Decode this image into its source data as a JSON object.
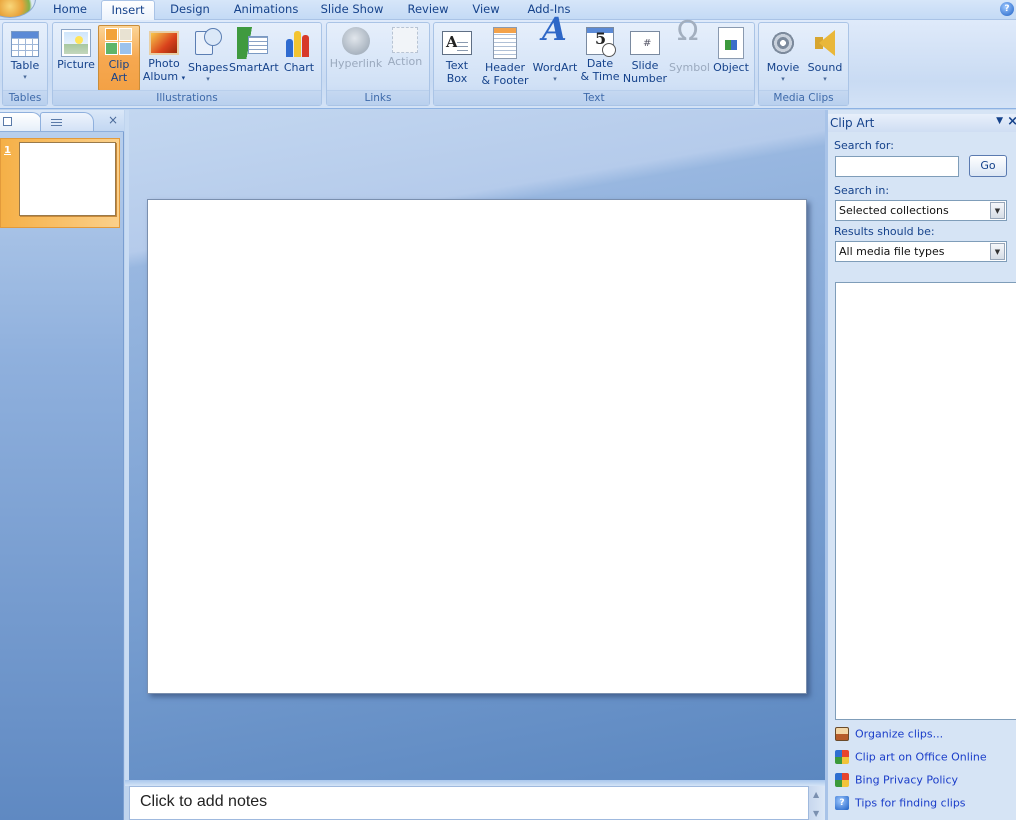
{
  "tabs": [
    {
      "label": "Home",
      "active": false
    },
    {
      "label": "Insert",
      "active": true
    },
    {
      "label": "Design",
      "active": false
    },
    {
      "label": "Animations",
      "active": false
    },
    {
      "label": "Slide Show",
      "active": false
    },
    {
      "label": "Review",
      "active": false
    },
    {
      "label": "View",
      "active": false
    },
    {
      "label": "Add-Ins",
      "active": false
    }
  ],
  "help_icon": "help-icon",
  "ribbon": {
    "groups": {
      "tables": "Tables",
      "illustrations": "Illustrations",
      "links": "Links",
      "text": "Text",
      "media_clips": "Media Clips"
    },
    "buttons": {
      "table": {
        "line1": "Table",
        "line2": "",
        "dropdown": true,
        "icon": "table-icon"
      },
      "picture": {
        "line1": "Picture",
        "line2": "",
        "icon": "picture-icon"
      },
      "clipart": {
        "line1": "Clip",
        "line2": "Art",
        "icon": "clipart-icon",
        "pressed": true
      },
      "photo_album": {
        "line1": "Photo",
        "line2": "Album",
        "dropdown": true,
        "icon": "photo-album-icon"
      },
      "shapes": {
        "line1": "Shapes",
        "line2": "",
        "dropdown": true,
        "icon": "shapes-icon"
      },
      "smartart": {
        "line1": "SmartArt",
        "line2": "",
        "icon": "smartart-icon"
      },
      "chart": {
        "line1": "Chart",
        "line2": "",
        "icon": "chart-icon"
      },
      "hyperlink": {
        "line1": "Hyperlink",
        "line2": "",
        "icon": "hyperlink-icon",
        "disabled": true
      },
      "action": {
        "line1": "Action",
        "line2": "",
        "icon": "action-icon",
        "disabled": true
      },
      "text_box": {
        "line1": "Text",
        "line2": "Box",
        "icon": "text-box-icon"
      },
      "header_footer": {
        "line1": "Header",
        "line2": "& Footer",
        "icon": "header-footer-icon"
      },
      "wordart": {
        "line1": "WordArt",
        "line2": "",
        "dropdown": true,
        "icon": "wordart-icon"
      },
      "date_time": {
        "line1": "Date",
        "line2": "& Time",
        "icon": "date-time-icon"
      },
      "slide_number": {
        "line1": "Slide",
        "line2": "Number",
        "icon": "slide-number-icon"
      },
      "symbol": {
        "line1": "Symbol",
        "line2": "",
        "icon": "symbol-icon",
        "disabled": true
      },
      "object": {
        "line1": "Object",
        "line2": "",
        "icon": "object-icon"
      },
      "movie": {
        "line1": "Movie",
        "line2": "",
        "dropdown": true,
        "icon": "movie-icon"
      },
      "sound": {
        "line1": "Sound",
        "line2": "",
        "dropdown": true,
        "icon": "sound-icon"
      }
    },
    "dropdown_glyph": "▾"
  },
  "slides_panel": {
    "tabs": [
      "slides-tab",
      "outline-tab"
    ],
    "close_glyph": "×",
    "slides": [
      {
        "number": "1",
        "selected": true
      }
    ]
  },
  "notes": {
    "placeholder": "Click to add notes"
  },
  "clip_art_pane": {
    "title": "Clip Art",
    "menu_glyph": "▼",
    "close_glyph": "×",
    "search_for_label": "Search for:",
    "search_value": "",
    "go_label": "Go",
    "search_in_label": "Search in:",
    "search_in_value": "Selected collections",
    "results_label": "Results should be:",
    "results_value": "All media file types",
    "combo_glyph": "▼",
    "links": [
      {
        "label": "Organize clips...",
        "icon": "organize-clips-icon"
      },
      {
        "label": "Clip art on Office Online",
        "icon": "office-online-icon"
      },
      {
        "label": "Bing Privacy Policy",
        "icon": "privacy-policy-icon"
      },
      {
        "label": "Tips for finding clips",
        "icon": "tips-icon"
      }
    ]
  },
  "colors": {
    "accent_text": "#15428b",
    "pressed_button": "#f6a850",
    "link": "#1a3dc9"
  }
}
